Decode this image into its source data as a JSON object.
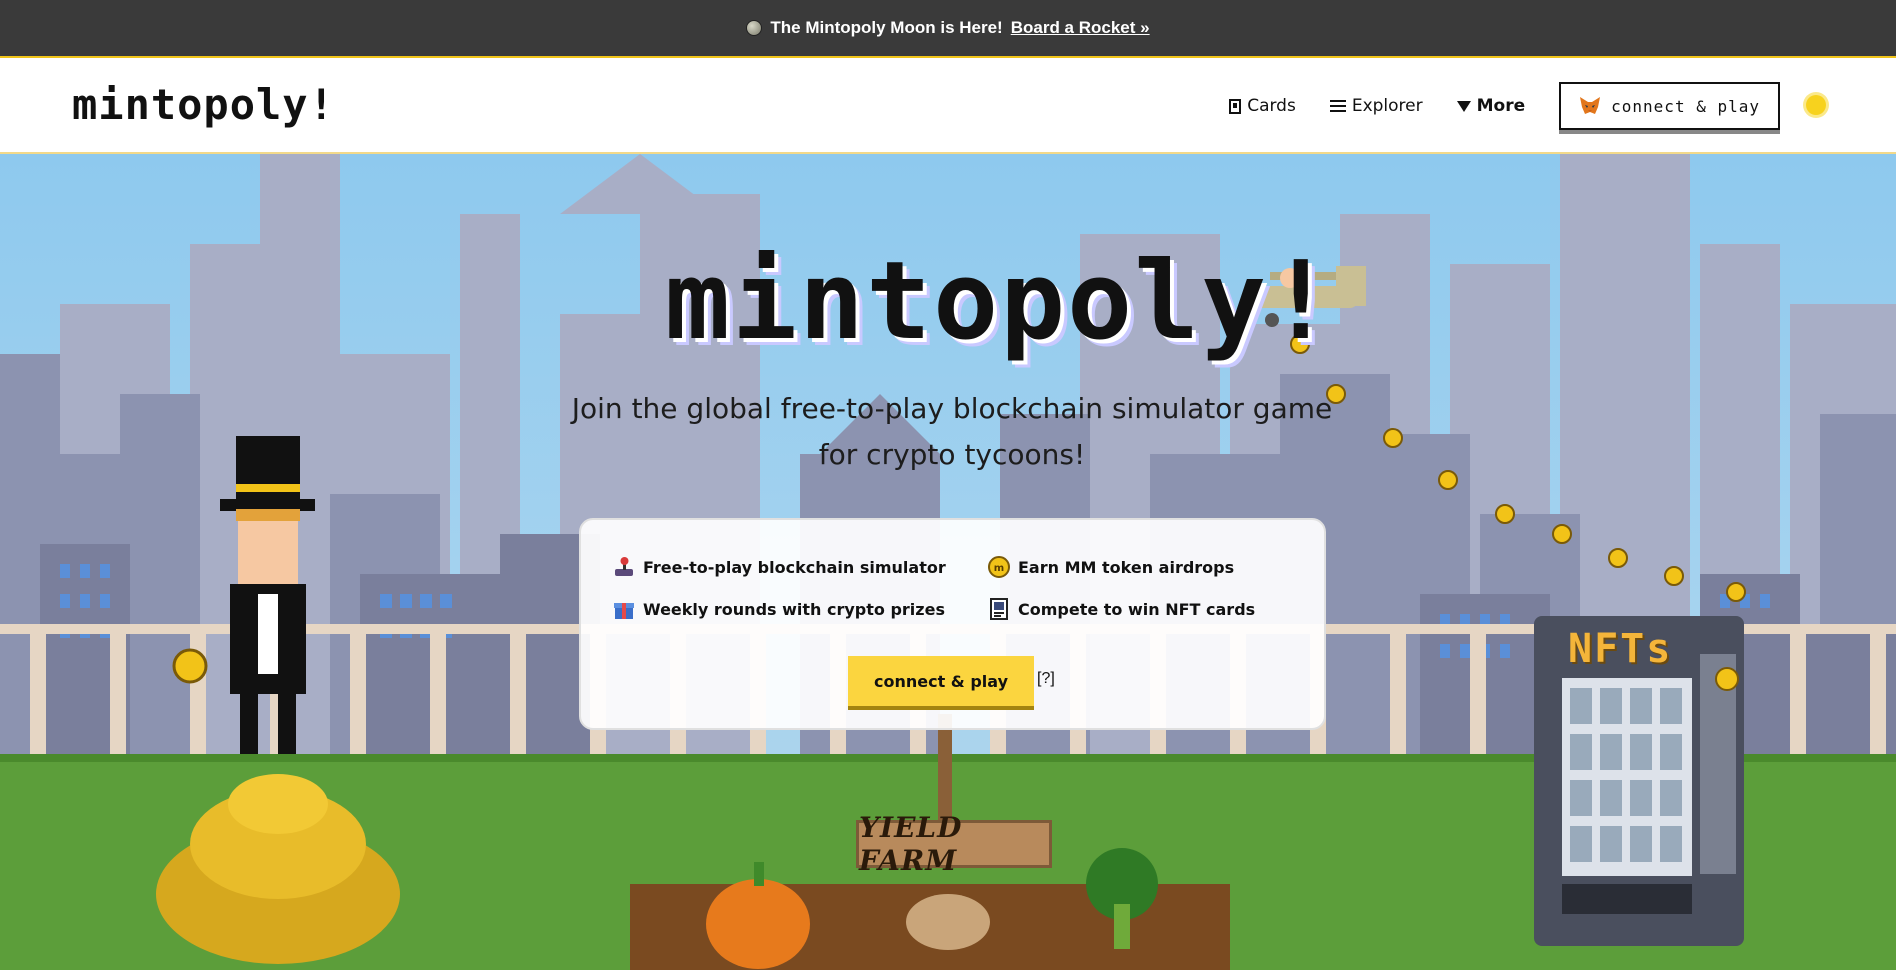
{
  "announcement": {
    "text": "The Mintopoly Moon is Here!",
    "link": "Board a Rocket »"
  },
  "nav": {
    "logo": "mintopoly!",
    "links": [
      {
        "label": "Cards",
        "icon": "card-icon"
      },
      {
        "label": "Explorer",
        "icon": "list-icon"
      },
      {
        "label": "More",
        "icon": "caret-down-icon"
      }
    ],
    "connect_label": "connect & play",
    "theme_icon": "sun-icon"
  },
  "hero": {
    "title": "mintopoly!",
    "tagline": "Join the global free-to-play blockchain simulator game for crypto tycoons!",
    "features": [
      {
        "label": "Free-to-play blockchain simulator",
        "icon": "joystick-icon"
      },
      {
        "label": "Earn MM token airdrops",
        "icon": "mm-coin-icon"
      },
      {
        "label": "Weekly rounds with crypto prizes",
        "icon": "gift-icon"
      },
      {
        "label": "Compete to win NFT cards",
        "icon": "nft-card-icon"
      }
    ],
    "cta_label": "connect & play",
    "help_label": "[?]",
    "sign_text": "YIELD FARM",
    "vending_label": "NFTs"
  },
  "colors": {
    "accent": "#fbd53f",
    "announce_bg": "#3a3a3a",
    "sky": "#8ec9ee",
    "grass": "#5c9e3a"
  }
}
